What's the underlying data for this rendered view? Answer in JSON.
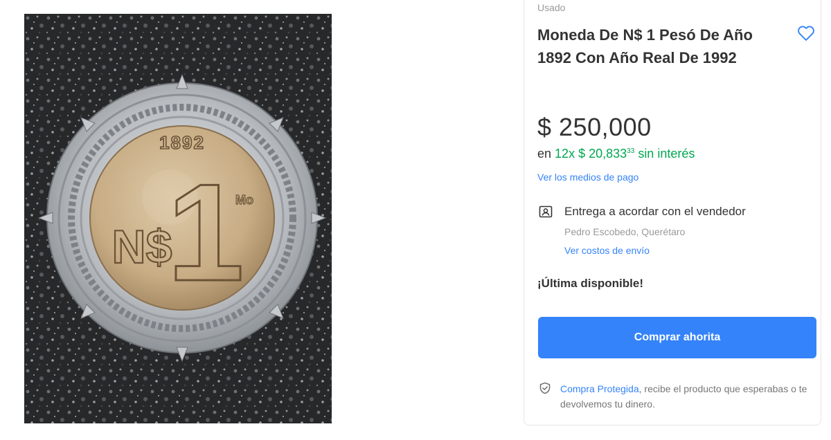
{
  "product": {
    "condition": "Usado",
    "title": "Moneda De N$ 1 Pesó De Año 1892 Con Año Real De 1992",
    "price": "$ 250,000",
    "installments": {
      "prefix": "en",
      "count": "12x",
      "amount": "$ 20,833",
      "cents": "33",
      "suffix": "sin interés"
    },
    "payment_link": "Ver los medios de pago"
  },
  "shipping": {
    "title": "Entrega a acordar con el vendedor",
    "location": "Pedro Escobedo, Querétaro",
    "costs_link": "Ver costos de envío"
  },
  "stock_label": "¡Última disponible!",
  "buy_button_label": "Comprar ahorita",
  "protection": {
    "link": "Compra Protegida",
    "text": ", recibe el producto que esperabas o te devolvemos tu dinero."
  },
  "coin": {
    "year": "1892",
    "denomination": "N$",
    "value": "1",
    "mint_mark": "Mo"
  },
  "icons": {
    "favorite": "heart-outline-icon",
    "shipping": "person-card-icon",
    "protection": "shield-check-icon"
  },
  "colors": {
    "accent": "#3483fa",
    "green": "#00a650",
    "text": "#333333",
    "muted": "#999999"
  }
}
